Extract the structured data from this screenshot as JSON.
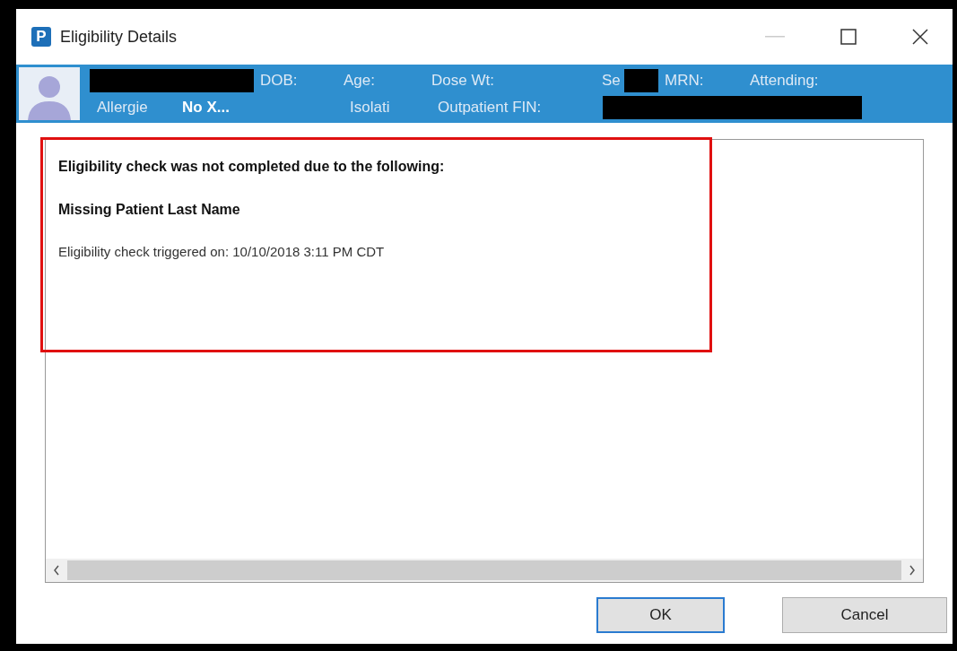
{
  "window": {
    "title": "Eligibility Details",
    "app_letter": "P"
  },
  "banner": {
    "rows": [
      [
        {
          "kind": "redacted"
        },
        {
          "kind": "label",
          "text": "DOB:"
        },
        {
          "kind": "label",
          "text": "Age:"
        },
        {
          "kind": "label",
          "text": "Dose Wt:"
        },
        {
          "kind": "label",
          "text": "Se"
        },
        {
          "kind": "redacted"
        },
        {
          "kind": "label",
          "text": "MRN:"
        },
        {
          "kind": "label",
          "text": "Attending:"
        }
      ],
      [
        {
          "kind": "label",
          "text": "Allergie"
        },
        {
          "kind": "value",
          "text": "No X..."
        },
        {
          "kind": "label",
          "text": "Isolati"
        },
        {
          "kind": "label",
          "text": "Outpatient FIN:"
        },
        {
          "kind": "redacted"
        }
      ]
    ]
  },
  "message": {
    "annotated": true,
    "heading": "Eligibility check was not completed due to the following:",
    "reason": "Missing Patient Last Name",
    "timestamp": "Eligibility check triggered on: 10/10/2018 3:11 PM CDT"
  },
  "buttons": [
    {
      "label": "OK",
      "default": true
    },
    {
      "label": "Cancel",
      "default": false
    }
  ]
}
